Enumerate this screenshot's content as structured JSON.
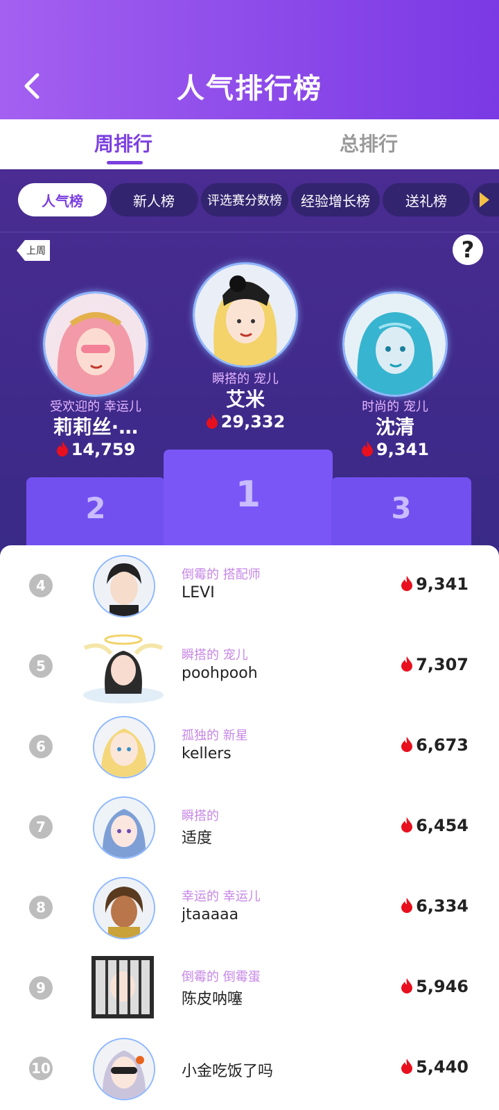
{
  "header": {
    "title": "人气排行榜"
  },
  "tabs": [
    {
      "label": "周排行"
    },
    {
      "label": "总排行"
    }
  ],
  "chips": [
    {
      "label": "人气榜"
    },
    {
      "label": "新人榜"
    },
    {
      "label": "评选赛分数榜"
    },
    {
      "label": "经验增长榜"
    },
    {
      "label": "送礼榜"
    }
  ],
  "last_week": "上周",
  "help": "?",
  "podium": [
    {
      "rank": "1",
      "subtitle": "瞬搭的 宠儿",
      "name": "艾米",
      "score": "29,332"
    },
    {
      "rank": "2",
      "subtitle": "受欢迎的 幸运儿",
      "name": "莉莉丝·…",
      "score": "14,759"
    },
    {
      "rank": "3",
      "subtitle": "时尚的 宠儿",
      "name": "沈清",
      "score": "9,341"
    }
  ],
  "list": [
    {
      "rank": "4",
      "subtitle": "倒霉的 搭配师",
      "name": "LEVI",
      "score": "9,341"
    },
    {
      "rank": "5",
      "subtitle": "瞬搭的 宠儿",
      "name": "poohpooh",
      "score": "7,307"
    },
    {
      "rank": "6",
      "subtitle": "孤独的 新星",
      "name": "kellers",
      "score": "6,673"
    },
    {
      "rank": "7",
      "subtitle": "瞬搭的",
      "name": "适度",
      "score": "6,454"
    },
    {
      "rank": "8",
      "subtitle": "幸运的 幸运儿",
      "name": "jtaaaaa",
      "score": "6,334"
    },
    {
      "rank": "9",
      "subtitle": "倒霉的 倒霉蛋",
      "name": "陈皮呐噻",
      "score": "5,946"
    },
    {
      "rank": "10",
      "subtitle": "",
      "name": "小金吃饭了吗",
      "score": "5,440"
    }
  ],
  "colors": {
    "accent": "#7b3fe0",
    "header": "#8e4cea",
    "podium": "#7250f0",
    "flame": "#e8101e"
  }
}
